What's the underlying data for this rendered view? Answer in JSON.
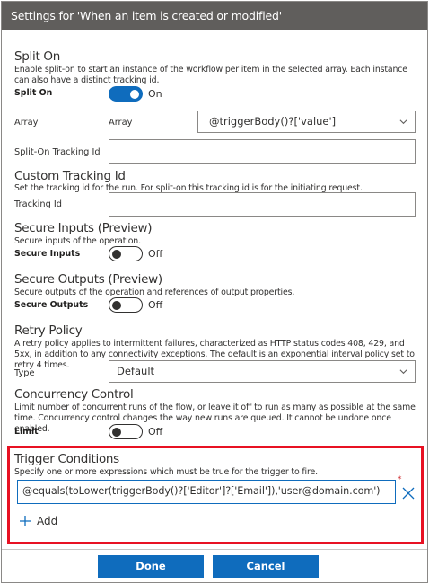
{
  "dialog": {
    "title": "Settings for 'When an item is created or modified'"
  },
  "split_on": {
    "title": "Split On",
    "description": "Enable split-on to start an instance of the workflow per item in the selected array. Each instance can also have a distinct tracking id.",
    "toggle_label": "Split On",
    "toggle_state": "On",
    "array_label": "Array",
    "array_sublabel": "Array",
    "array_value": "@triggerBody()?['value']",
    "tracking_label": "Split-On Tracking Id",
    "tracking_value": ""
  },
  "custom_tracking": {
    "title": "Custom Tracking Id",
    "description": "Set the tracking id for the run. For split-on this tracking id is for the initiating request.",
    "label": "Tracking Id",
    "value": ""
  },
  "secure_inputs": {
    "title": "Secure Inputs (Preview)",
    "description": "Secure inputs of the operation.",
    "toggle_label": "Secure Inputs",
    "toggle_state": "Off"
  },
  "secure_outputs": {
    "title": "Secure Outputs (Preview)",
    "description": "Secure outputs of the operation and references of output properties.",
    "toggle_label": "Secure Outputs",
    "toggle_state": "Off"
  },
  "retry": {
    "title": "Retry Policy",
    "description": "A retry policy applies to intermittent failures, characterized as HTTP status codes 408, 429, and 5xx, in addition to any connectivity exceptions. The default is an exponential interval policy set to retry 4 times.",
    "type_label": "Type",
    "type_value": "Default"
  },
  "concurrency": {
    "title": "Concurrency Control",
    "description": "Limit number of concurrent runs of the flow, or leave it off to run as many as possible at the same time. Concurrency control changes the way new runs are queued. It cannot be undone once enabled.",
    "toggle_label": "Limit",
    "toggle_state": "Off"
  },
  "trigger_conditions": {
    "title": "Trigger Conditions",
    "description": "Specify one or more expressions which must be true for the trigger to fire.",
    "condition_value": "@equals(toLower(triggerBody()?['Editor']?['Email']),'user@domain.com')",
    "required_mark": "*",
    "add_label": "Add"
  },
  "footer": {
    "done_label": "Done",
    "cancel_label": "Cancel"
  },
  "colors": {
    "accent": "#0f6cbd",
    "titlebar": "#605e5c",
    "highlight": "#e81123"
  }
}
